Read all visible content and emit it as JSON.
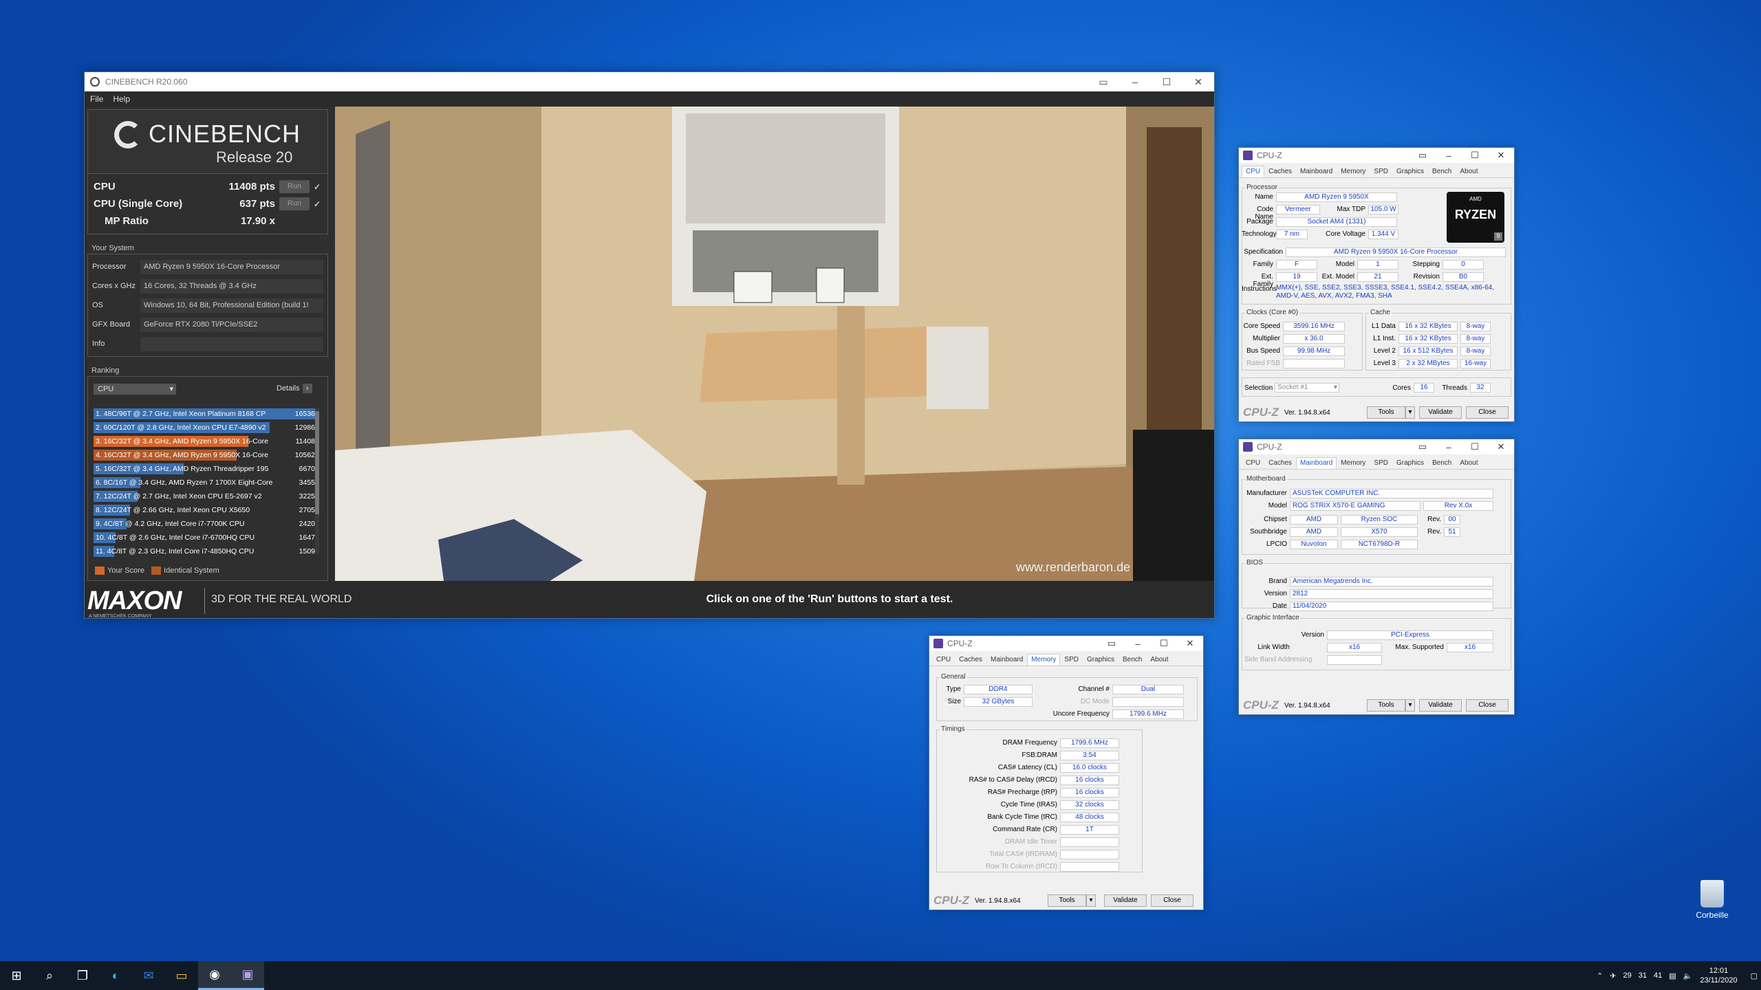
{
  "cinebench": {
    "title": "CINEBENCH R20.060",
    "menu": [
      "File",
      "Help"
    ],
    "logo_main": "CINEBENCH",
    "logo_sub": "Release 20",
    "scores": [
      {
        "name": "CPU",
        "value": "11408 pts",
        "run": "Run",
        "check": "✓"
      },
      {
        "name": "CPU (Single Core)",
        "value": "637 pts",
        "run": "Run",
        "check": "✓"
      },
      {
        "name": "MP Ratio",
        "value": "17.90 x"
      }
    ],
    "your_system_label": "Your System",
    "system": [
      {
        "k": "Processor",
        "v": "AMD Ryzen 9 5950X 16-Core Processor"
      },
      {
        "k": "Cores x GHz",
        "v": "16 Cores, 32 Threads @ 3.4 GHz"
      },
      {
        "k": "OS",
        "v": "Windows 10, 64 Bit, Professional Edition (build 1!"
      },
      {
        "k": "GFX Board",
        "v": "GeForce RTX 2080 Ti/PCIe/SSE2"
      },
      {
        "k": "Info",
        "v": ""
      }
    ],
    "ranking_label": "Ranking",
    "ranking_select": "CPU",
    "details_label": "Details",
    "ranking": [
      {
        "t": "1. 48C/96T @ 2.7 GHz, Intel Xeon Platinum 8168 CP",
        "s": "16536",
        "kind": "other"
      },
      {
        "t": "2. 60C/120T @ 2.8 GHz, Intel Xeon CPU E7-4890 v2",
        "s": "12986",
        "kind": "other"
      },
      {
        "t": "3. 16C/32T @ 3.4 GHz, AMD Ryzen 9 5950X 16-Core",
        "s": "11408",
        "kind": "me"
      },
      {
        "t": "4. 16C/32T @ 3.4 GHz, AMD Ryzen 9 5950X 16-Core",
        "s": "10562",
        "kind": "id"
      },
      {
        "t": "5. 16C/32T @ 3.4 GHz, AMD Ryzen Threadripper 195",
        "s": "6670",
        "kind": "other"
      },
      {
        "t": "6. 8C/16T @ 3.4 GHz, AMD Ryzen 7 1700X Eight-Core",
        "s": "3455",
        "kind": "other"
      },
      {
        "t": "7. 12C/24T @ 2.7 GHz, Intel Xeon CPU E5-2697 v2",
        "s": "3225",
        "kind": "other"
      },
      {
        "t": "8. 12C/24T @ 2.66 GHz, Intel Xeon CPU X5650",
        "s": "2705",
        "kind": "other"
      },
      {
        "t": "9. 4C/8T @ 4.2 GHz, Intel Core i7-7700K CPU",
        "s": "2420",
        "kind": "other"
      },
      {
        "t": "10. 4C/8T @ 2.6 GHz, Intel Core i7-6700HQ CPU",
        "s": "1647",
        "kind": "other"
      },
      {
        "t": "11. 4C/8T @ 2.3 GHz, Intel Core i7-4850HQ CPU",
        "s": "1509",
        "kind": "other"
      }
    ],
    "legend_your": "Your Score",
    "legend_identical": "Identical System",
    "maxon": "MAXON",
    "maxon_sub": "A NEMETSCHEK COMPANY",
    "tagline": "3D FOR THE REAL WORLD",
    "status": "Click on one of the 'Run' buttons to start a test.",
    "watermark": "www.renderbaron.de"
  },
  "cpuz_common": {
    "title": "CPU-Z",
    "tabs": [
      "CPU",
      "Caches",
      "Mainboard",
      "Memory",
      "SPD",
      "Graphics",
      "Bench",
      "About"
    ],
    "brand": "CPU-Z",
    "version": "Ver. 1.94.8.x64",
    "tools": "Tools",
    "validate": "Validate",
    "close": "Close"
  },
  "cpuz_cpu": {
    "processor_label": "Processor",
    "name": "AMD Ryzen 9 5950X",
    "codename": "Vermeer",
    "maxtdp": "105.0 W",
    "package": "Socket AM4 (1331)",
    "technology": "7 nm",
    "voltage": "1.344 V",
    "spec": "AMD Ryzen 9 5950X 16-Core Processor",
    "family": "F",
    "model": "1",
    "stepping": "0",
    "extfamily": "19",
    "extmodel": "21",
    "revision": "B0",
    "instructions": "MMX(+), SSE, SSE2, SSE3, SSSE3, SSE4.1, SSE4.2, SSE4A, x86-64, AMD-V, AES, AVX, AVX2, FMA3, SHA",
    "clocks_label": "Clocks (Core #0)",
    "corespeed": "3599.16 MHz",
    "multiplier": "x 36.0",
    "busspeed": "99.98 MHz",
    "cache_label": "Cache",
    "l1d": "16 x 32 KBytes",
    "l1dw": "8-way",
    "l1i": "16 x 32 KBytes",
    "l1iw": "8-way",
    "l2": "16 x 512 KBytes",
    "l2w": "8-way",
    "l3": "2 x 32 MBytes",
    "l3w": "16-way",
    "selection": "Socket #1",
    "cores": "16",
    "threads": "32",
    "labels": {
      "name": "Name",
      "codename": "Code Name",
      "maxtdp": "Max TDP",
      "package": "Package",
      "technology": "Technology",
      "voltage": "Core Voltage",
      "spec": "Specification",
      "family": "Family",
      "model": "Model",
      "stepping": "Stepping",
      "extfamily": "Ext. Family",
      "extmodel": "Ext. Model",
      "revision": "Revision",
      "instructions": "Instructions",
      "corespeed": "Core Speed",
      "multiplier": "Multiplier",
      "busspeed": "Bus Speed",
      "ratedfsb": "Rated FSB",
      "l1d": "L1 Data",
      "l1i": "L1 Inst.",
      "l2": "Level 2",
      "l3": "Level 3",
      "selection": "Selection",
      "cores": "Cores",
      "threads": "Threads"
    },
    "logo_top": "AMD",
    "logo_main": "RYZEN",
    "logo_num": "9"
  },
  "cpuz_mb": {
    "mb_label": "Motherboard",
    "manufacturer": "ASUSTeK COMPUTER INC.",
    "model": "ROG STRIX X570-E GAMING",
    "rev": "Rev X.0x",
    "chipset_v": "AMD",
    "chipset_m": "Ryzen SOC",
    "chipset_rev": "00",
    "south_v": "AMD",
    "south_m": "X570",
    "south_rev": "51",
    "lpcio_v": "Nuvoton",
    "lpcio_m": "NCT6798D-R",
    "bios_label": "BIOS",
    "brand": "American Megatrends Inc.",
    "version": "2812",
    "date": "11/04/2020",
    "gi_label": "Graphic Interface",
    "gi_version": "PCI-Express",
    "linkwidth": "x16",
    "maxsup": "x16",
    "labels": {
      "manufacturer": "Manufacturer",
      "model": "Model",
      "chipset": "Chipset",
      "southbridge": "Southbridge",
      "lpcio": "LPCIO",
      "rev": "Rev.",
      "brand": "Brand",
      "version": "Version",
      "date": "Date",
      "linkwidth": "Link Width",
      "maxsup": "Max. Supported",
      "sideband": "Side Band Addressing"
    }
  },
  "cpuz_mem": {
    "general_label": "General",
    "type": "DDR4",
    "size": "32 GBytes",
    "channel": "Dual",
    "uncore": "1799.6 MHz",
    "timings_label": "Timings",
    "dram": "1799.6 MHz",
    "fsb": "3:54",
    "cl": "16.0 clocks",
    "trcd": "16 clocks",
    "trp": "16 clocks",
    "tras": "32 clocks",
    "trc": "48 clocks",
    "cr": "1T",
    "labels": {
      "type": "Type",
      "size": "Size",
      "channel": "Channel #",
      "dcmode": "DC Mode",
      "uncore": "Uncore Frequency",
      "dram": "DRAM Frequency",
      "fsb": "FSB:DRAM",
      "cl": "CAS# Latency (CL)",
      "trcd": "RAS# to CAS# Delay (tRCD)",
      "trp": "RAS# Precharge (tRP)",
      "tras": "Cycle Time (tRAS)",
      "trc": "Bank Cycle Time (tRC)",
      "cr": "Command Rate (CR)",
      "idle": "DRAM Idle Timer",
      "trdram": "Total CAS# (tRDRAM)",
      "trcd2": "Row To Column (tRCD)"
    }
  },
  "desktop": {
    "recycle": "Corbeille"
  },
  "taskbar": {
    "time": "12:01",
    "date": "23/11/2020",
    "tray_nums": [
      "29",
      "31",
      "41"
    ]
  }
}
